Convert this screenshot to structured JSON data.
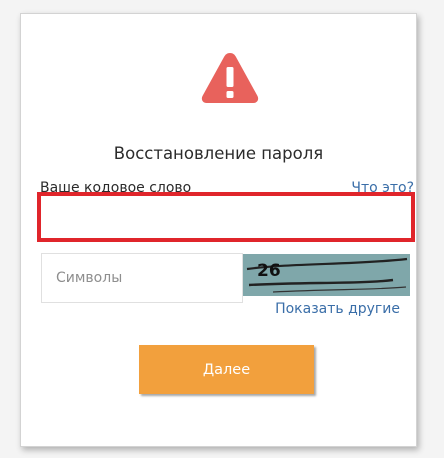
{
  "dialog": {
    "title": "Восстановление пароля",
    "codeword_label": "Ваше кодовое слово",
    "help_link": "Что это?",
    "codeword_value": "",
    "captcha_placeholder": "Символы",
    "captcha_text": "26",
    "show_others_link": "Показать другие",
    "next_button": "Далее"
  },
  "colors": {
    "warning": "#e8625c",
    "input_error_border": "#e0252b",
    "link": "#3a6ea8",
    "button": "#f2a03d",
    "captcha_bg": "#7fa7aa"
  },
  "icons": {
    "warning": "warning-triangle-icon"
  }
}
